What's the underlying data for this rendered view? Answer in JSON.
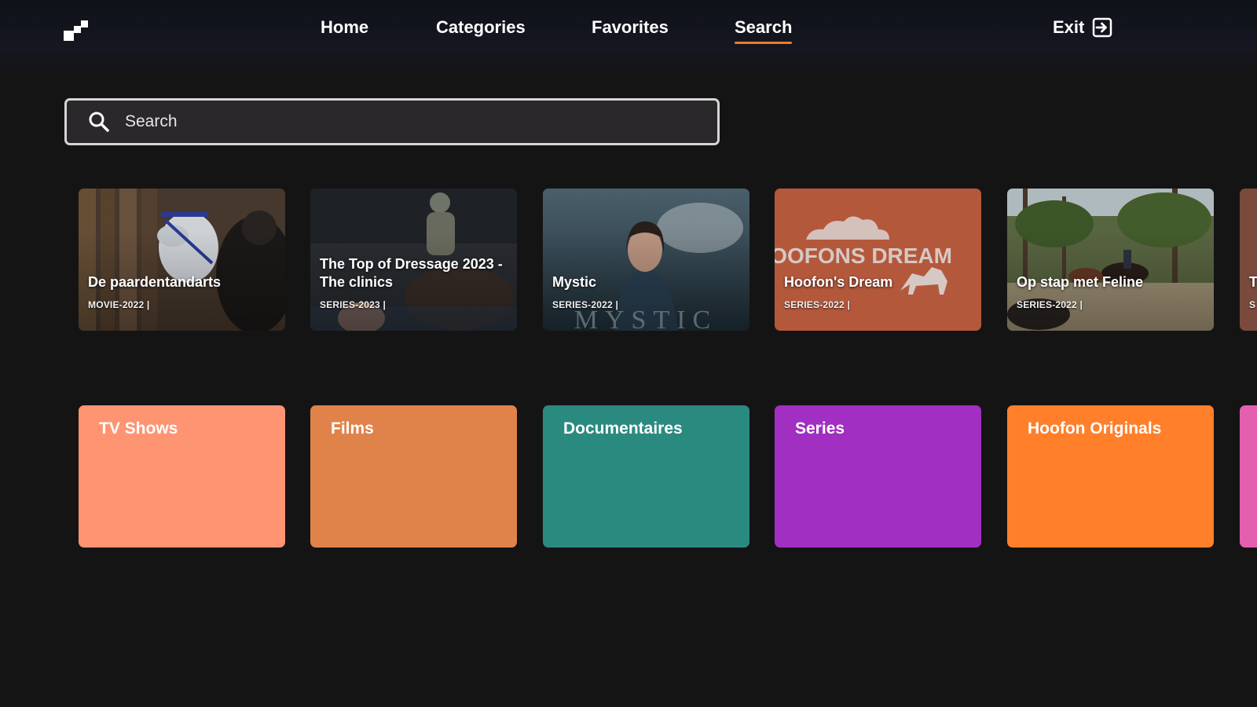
{
  "nav": {
    "items": [
      {
        "label": "Home"
      },
      {
        "label": "Categories"
      },
      {
        "label": "Favorites"
      },
      {
        "label": "Search"
      }
    ],
    "active": "Search",
    "exit_label": "Exit"
  },
  "search": {
    "placeholder": "Search",
    "value": ""
  },
  "results": [
    {
      "title": "De paardentandarts",
      "meta": "MOVIE-2022 |",
      "art": "stable-horse"
    },
    {
      "title": "The Top of Dressage 2023 - The clinics",
      "meta": "SERIES-2023 |",
      "art": "dressage-arena"
    },
    {
      "title": "Mystic",
      "meta": "SERIES-2022 |",
      "art": "mystic-poster",
      "poster_text": "MYSTIC"
    },
    {
      "title": "Hoofon's Dream",
      "meta": "SERIES-2022 |",
      "art": "hoofons-dream-logo",
      "poster_text": "HOOFONS DREAM",
      "accent": "#b4583c"
    },
    {
      "title": "Op stap met Feline",
      "meta": "SERIES-2022 |",
      "art": "forest-riders"
    },
    {
      "title": "T",
      "meta": "S",
      "art": "partial-card"
    }
  ],
  "categories": [
    {
      "label": "TV Shows",
      "color": "#ff9472"
    },
    {
      "label": "Films",
      "color": "#e0834b"
    },
    {
      "label": "Documentaires",
      "color": "#2b8a80"
    },
    {
      "label": "Series",
      "color": "#a12fc2"
    },
    {
      "label": "Hoofon Originals",
      "color": "#ff7f2a"
    },
    {
      "label": "",
      "color": "#e45fb0"
    }
  ],
  "colors": {
    "background": "#151415",
    "active_underline": "#f07a2a",
    "search_border": "#d5d5d5",
    "search_fill": "#2a282a"
  },
  "icons": {
    "logo": "app-logo-icon",
    "exit": "exit-icon",
    "search": "search-icon"
  }
}
